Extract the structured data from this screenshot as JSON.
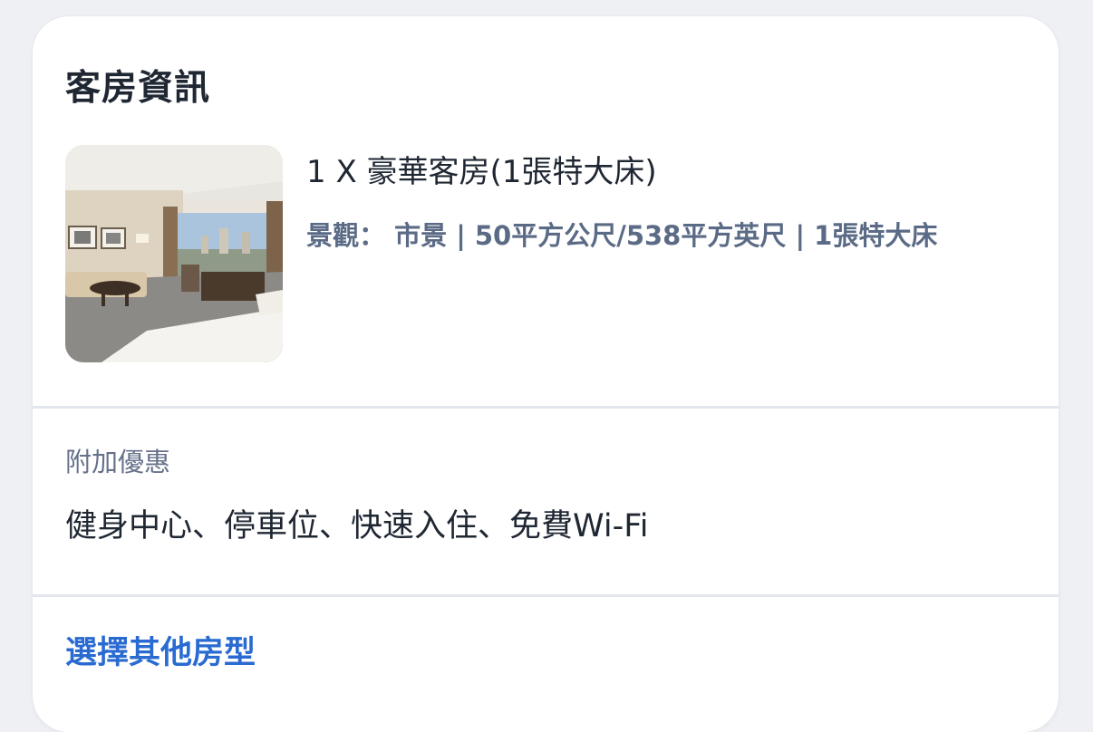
{
  "card": {
    "title": "客房資訊",
    "room": {
      "name": "1 X 豪華客房(1張特大床)",
      "detail": "景觀： 市景 | 50平方公尺/538平方英尺 | 1張特大床",
      "photo": "hotel-room-photo"
    },
    "perks": {
      "label": "附加優惠",
      "value": "健身中心、停車位、快速入住、免費Wi-Fi"
    },
    "link_label": "選擇其他房型"
  },
  "colors": {
    "title": "#1f2733",
    "detail": "#5b6b86",
    "muted": "#66718a",
    "link": "#2a6bd1",
    "divider": "#e3e6ee"
  }
}
